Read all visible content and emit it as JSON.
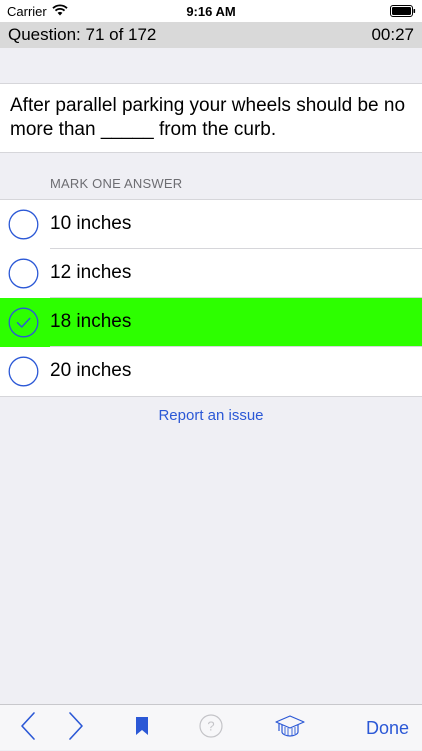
{
  "status_bar": {
    "carrier": "Carrier",
    "time": "9:16 AM"
  },
  "header": {
    "question_counter": "Question: 71 of 172",
    "timer": "00:27"
  },
  "question": {
    "text": "After parallel parking your wheels should be no more than _____ from the curb."
  },
  "answers_section": {
    "label": "MARK ONE ANSWER",
    "options": [
      {
        "label": "10 inches",
        "selected": false
      },
      {
        "label": "12 inches",
        "selected": false
      },
      {
        "label": "18 inches",
        "selected": true
      },
      {
        "label": "20 inches",
        "selected": false
      }
    ]
  },
  "report_link": "Report an issue",
  "toolbar": {
    "prev_icon": "chevron-left-icon",
    "next_icon": "chevron-right-icon",
    "bookmark_icon": "bookmark-icon",
    "help_icon": "question-circle-icon",
    "study_icon": "graduation-cap-icon",
    "done_label": "Done"
  },
  "colors": {
    "accent": "#2b58d6",
    "selected_answer": "#2dff00",
    "header_bg": "#d9d9d9"
  }
}
